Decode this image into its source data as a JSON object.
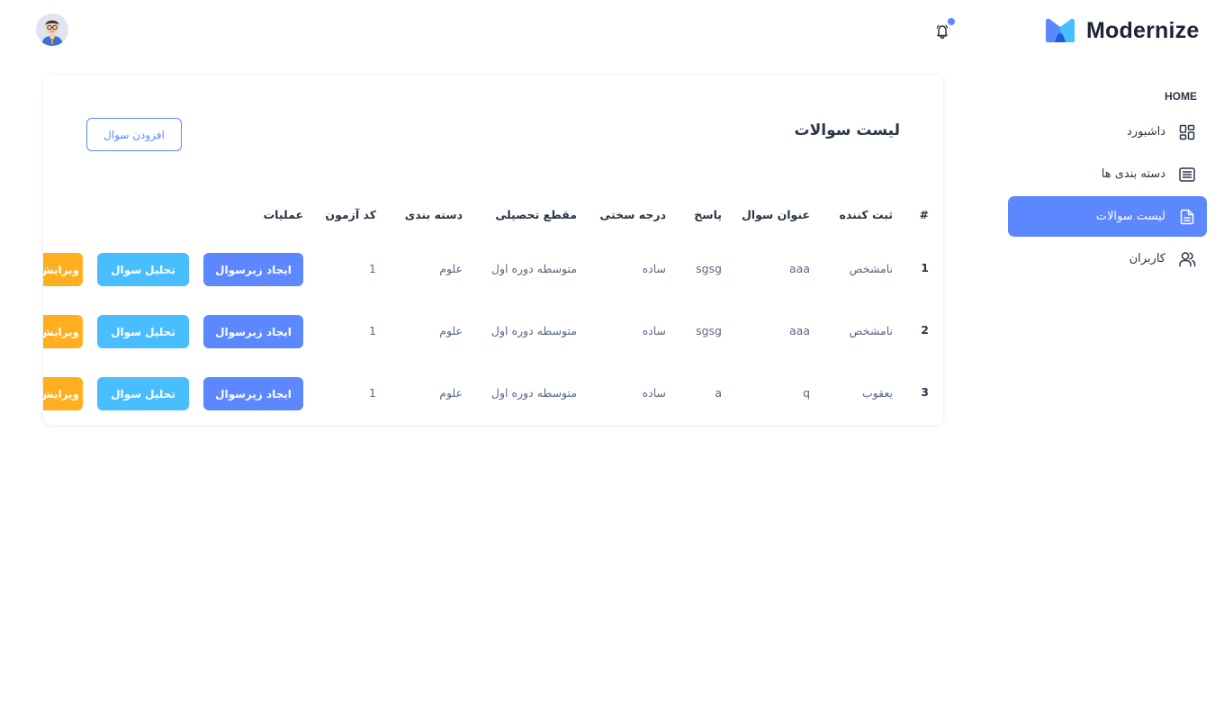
{
  "brand": {
    "name": "Modernize",
    "colors": {
      "accent": "#5d87ff",
      "info": "#49beff",
      "warning": "#ffae1f",
      "text": "#2a3547"
    }
  },
  "header": {
    "notification_icon": "bell-icon",
    "has_notification": true,
    "avatar_icon": "user-avatar"
  },
  "sidebar": {
    "caption": "HOME",
    "items": [
      {
        "label": "داشبورد",
        "icon": "dashboard-icon",
        "active": false
      },
      {
        "label": "دسته بندی ها",
        "icon": "list-details-icon",
        "active": false
      },
      {
        "label": "لیست سوالات",
        "icon": "file-description-icon",
        "active": true
      },
      {
        "label": "کاربران",
        "icon": "users-icon",
        "active": false
      }
    ]
  },
  "main": {
    "title": "لیست سوالات",
    "add_button": "افزودن سوال",
    "table": {
      "headers": [
        "#",
        "ثبت کننده",
        "عنوان سوال",
        "پاسخ",
        "درجه سختی",
        "مقطع تحصیلی",
        "دسته بندی",
        "کد آزمون",
        "عملیات"
      ],
      "rows": [
        {
          "num": "1",
          "creator": "نامشخص",
          "title": "aaa",
          "answer": "sgsg",
          "difficulty": "ساده",
          "grade": "متوسطه دوره اول",
          "category": "علوم",
          "exam_code": "1"
        },
        {
          "num": "2",
          "creator": "نامشخص",
          "title": "aaa",
          "answer": "sgsg",
          "difficulty": "ساده",
          "grade": "متوسطه دوره اول",
          "category": "علوم",
          "exam_code": "1"
        },
        {
          "num": "3",
          "creator": "یعقوب",
          "title": "q",
          "answer": "a",
          "difficulty": "ساده",
          "grade": "متوسطه دوره اول",
          "category": "علوم",
          "exam_code": "1"
        }
      ],
      "actions": {
        "create_sub": "ایجاد زیرسوال",
        "analyze": "تحلیل سوال",
        "edit": "ویرایش"
      }
    }
  }
}
